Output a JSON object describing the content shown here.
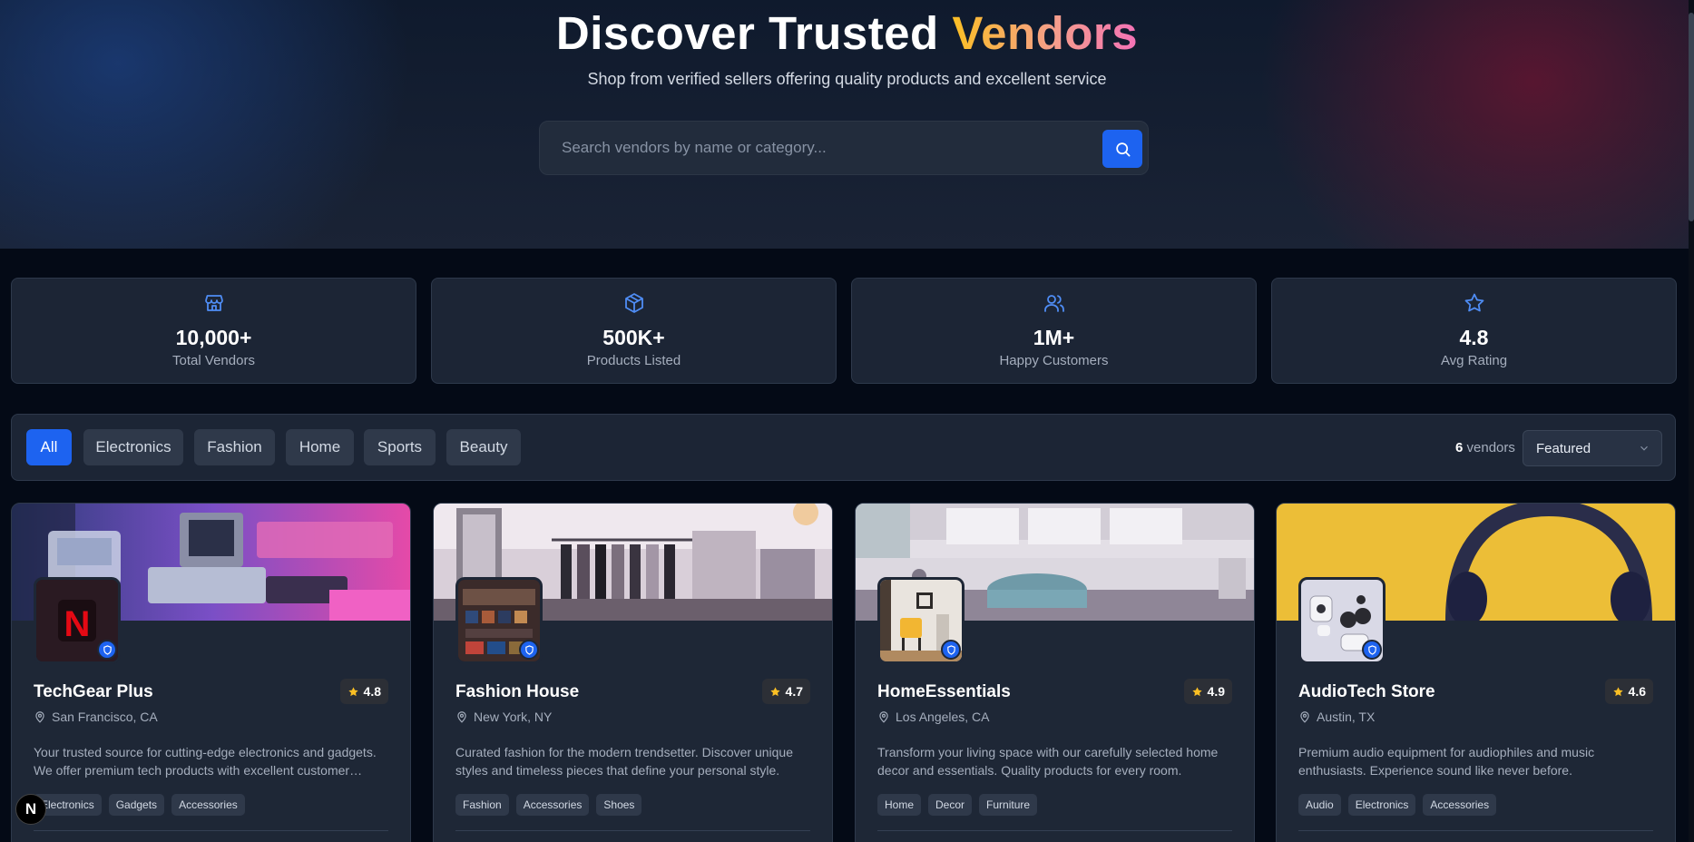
{
  "hero": {
    "title_main": "Discover Trusted ",
    "title_accent": "Vendors",
    "subtitle": "Shop from verified sellers offering quality products and excellent service",
    "search_placeholder": "Search vendors by name or category..."
  },
  "stats": [
    {
      "icon": "store-icon",
      "value": "10,000+",
      "label": "Total Vendors"
    },
    {
      "icon": "package-icon",
      "value": "500K+",
      "label": "Products Listed"
    },
    {
      "icon": "users-icon",
      "value": "1M+",
      "label": "Happy Customers"
    },
    {
      "icon": "star-icon",
      "value": "4.8",
      "label": "Avg Rating"
    }
  ],
  "filters": {
    "categories": [
      "All",
      "Electronics",
      "Fashion",
      "Home",
      "Sports",
      "Beauty"
    ],
    "active": "All",
    "count": "6",
    "count_suffix": "vendors",
    "sort_value": "Featured"
  },
  "vendors": [
    {
      "name": "TechGear Plus",
      "rating": "4.8",
      "location": "San Francisco, CA",
      "description": "Your trusted source for cutting-edge electronics and gadgets. We offer premium tech products with excellent customer service.",
      "tags": [
        "Electronics",
        "Gadgets",
        "Accessories"
      ],
      "avatar_letter": "N"
    },
    {
      "name": "Fashion House",
      "rating": "4.7",
      "location": "New York, NY",
      "description": "Curated fashion for the modern trendsetter. Discover unique styles and timeless pieces that define your personal style.",
      "tags": [
        "Fashion",
        "Accessories",
        "Shoes"
      ]
    },
    {
      "name": "HomeEssentials",
      "rating": "4.9",
      "location": "Los Angeles, CA",
      "description": "Transform your living space with our carefully selected home decor and essentials. Quality products for every room.",
      "tags": [
        "Home",
        "Decor",
        "Furniture"
      ]
    },
    {
      "name": "AudioTech Store",
      "rating": "4.6",
      "location": "Austin, TX",
      "description": "Premium audio equipment for audiophiles and music enthusiasts. Experience sound like never before.",
      "tags": [
        "Audio",
        "Electronics",
        "Accessories"
      ]
    }
  ],
  "colors": {
    "accent": "#1d63f0",
    "star": "#fbbf24",
    "background": "#040a16",
    "card": "#1e2736"
  },
  "dev_badge": "N"
}
